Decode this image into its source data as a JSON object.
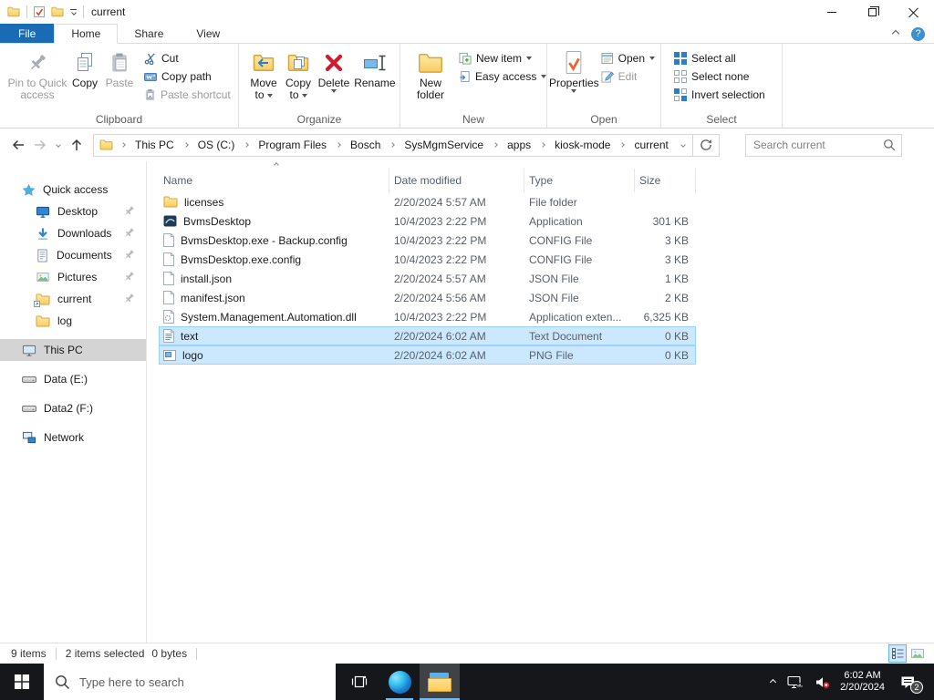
{
  "titlebar": {
    "title": "current",
    "qat_icons": [
      "explorer-folder",
      "properties-check",
      "new-folder",
      "customize-arrow"
    ]
  },
  "tabs": {
    "file": "File",
    "home": "Home",
    "share": "Share",
    "view": "View"
  },
  "ribbon": {
    "clipboard": {
      "caption": "Clipboard",
      "pin_line1": "Pin to Quick",
      "pin_line2": "access",
      "copy": "Copy",
      "paste": "Paste",
      "cut": "Cut",
      "copy_path": "Copy path",
      "paste_shortcut": "Paste shortcut"
    },
    "organize": {
      "caption": "Organize",
      "move_line1": "Move",
      "move_line2": "to",
      "copyto_line1": "Copy",
      "copyto_line2": "to",
      "delete": "Delete",
      "rename": "Rename"
    },
    "new": {
      "caption": "New",
      "folder_line1": "New",
      "folder_line2": "folder",
      "new_item": "New item",
      "easy_access": "Easy access"
    },
    "open": {
      "caption": "Open",
      "properties": "Properties",
      "open": "Open",
      "edit": "Edit"
    },
    "select": {
      "caption": "Select",
      "all": "Select all",
      "none": "Select none",
      "invert": "Invert selection"
    }
  },
  "address": {
    "crumbs": [
      "This PC",
      "OS (C:)",
      "Program Files",
      "Bosch",
      "SysMgmService",
      "apps",
      "kiosk-mode",
      "current"
    ],
    "search_placeholder": "Search current"
  },
  "sidebar": {
    "quick_access": "Quick access",
    "items": [
      "Desktop",
      "Downloads",
      "Documents",
      "Pictures",
      "current",
      "log"
    ],
    "this_pc": "This PC",
    "drives": [
      "Data (E:)",
      "Data2 (F:)"
    ],
    "network": "Network"
  },
  "files": {
    "columns": [
      "Name",
      "Date modified",
      "Type",
      "Size"
    ],
    "rows": [
      {
        "icon": "folder-icon",
        "name": "licenses",
        "modified": "2/20/2024 5:57 AM",
        "type": "File folder",
        "size": ""
      },
      {
        "icon": "application-icon",
        "name": "BvmsDesktop",
        "modified": "10/4/2023 2:22 PM",
        "type": "Application",
        "size": "301 KB"
      },
      {
        "icon": "config-file-icon",
        "name": "BvmsDesktop.exe - Backup.config",
        "modified": "10/4/2023 2:22 PM",
        "type": "CONFIG File",
        "size": "3 KB"
      },
      {
        "icon": "config-file-icon",
        "name": "BvmsDesktop.exe.config",
        "modified": "10/4/2023 2:22 PM",
        "type": "CONFIG File",
        "size": "3 KB"
      },
      {
        "icon": "json-file-icon",
        "name": "install.json",
        "modified": "2/20/2024 5:57 AM",
        "type": "JSON File",
        "size": "1 KB"
      },
      {
        "icon": "json-file-icon",
        "name": "manifest.json",
        "modified": "2/20/2024 5:56 AM",
        "type": "JSON File",
        "size": "2 KB"
      },
      {
        "icon": "dll-file-icon",
        "name": "System.Management.Automation.dll",
        "modified": "10/4/2023 2:22 PM",
        "type": "Application exten...",
        "size": "6,325 KB"
      },
      {
        "icon": "text-file-icon",
        "name": "text",
        "modified": "2/20/2024 6:02 AM",
        "type": "Text Document",
        "size": "0 KB",
        "selected": true
      },
      {
        "icon": "image-file-icon",
        "name": "logo",
        "modified": "2/20/2024 6:02 AM",
        "type": "PNG File",
        "size": "0 KB",
        "selected": true
      }
    ]
  },
  "status": {
    "items": "9 items",
    "selected": "2 items selected",
    "bytes": "0 bytes"
  },
  "taskbar": {
    "search_placeholder": "Type here to search",
    "time": "6:02 AM",
    "date": "2/20/2024",
    "badge": "2",
    "tray_icons": [
      "hidden-icons",
      "network",
      "volume-muted",
      "notifications"
    ]
  },
  "colors": {
    "file_tab_blue": "#1a6bb6",
    "accent_blue": "#2b7cd3",
    "selection_bg": "#cce8ff",
    "selection_border": "#99d1ff",
    "delete_red": "#d21a2c",
    "folder_yellow": "#fcd462",
    "taskbar_bg": "#16171b"
  }
}
